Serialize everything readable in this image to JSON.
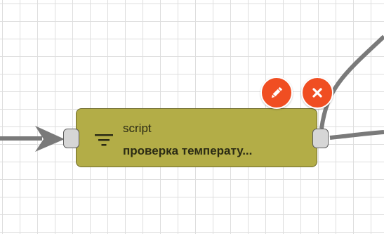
{
  "node": {
    "type_label": "script",
    "title": "проверка температу...",
    "icon": "filter-icon",
    "fill_color": "#b3ad47"
  },
  "actions": {
    "edit_icon": "pencil-icon",
    "delete_icon": "close-icon",
    "button_color": "#f04e22"
  },
  "edges": {
    "color": "#7a7a7a"
  }
}
